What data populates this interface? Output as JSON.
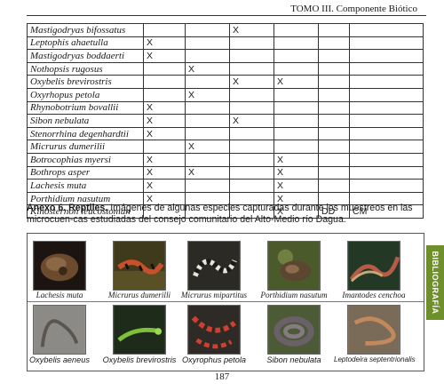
{
  "header": {
    "title": "TOMO III. Componente Biótico"
  },
  "table": {
    "rows": [
      [
        "Mastigodryas bifossatus",
        "",
        "",
        "X",
        "",
        "",
        ""
      ],
      [
        "Leptophis ahaetulla",
        "X",
        "",
        "",
        "",
        "",
        ""
      ],
      [
        "Mastigodryas boddaerti",
        "X",
        "",
        "",
        "",
        "",
        ""
      ],
      [
        "Nothopsis rugosus",
        "",
        "X",
        "",
        "",
        "",
        ""
      ],
      [
        "Oxybelis brevirostris",
        "",
        "",
        "X",
        "X",
        "",
        ""
      ],
      [
        "Oxyrhopus petola",
        "",
        "X",
        "",
        "",
        "",
        ""
      ],
      [
        "Rhynobotrium bovallii",
        "X",
        "",
        "",
        "",
        "",
        ""
      ],
      [
        "Sibon nebulata",
        "X",
        "",
        "X",
        "",
        "",
        ""
      ],
      [
        "Stenorrhina degenhardtii",
        "X",
        "",
        "",
        "",
        "",
        ""
      ],
      [
        "Micrurus dumerilii",
        "",
        "X",
        "",
        "",
        "",
        ""
      ],
      [
        "Botrocophias myersi",
        "X",
        "",
        "",
        "X",
        "",
        ""
      ],
      [
        "Bothrops asper",
        "X",
        "X",
        "",
        "X",
        "",
        ""
      ],
      [
        "Lachesis muta",
        "X",
        "",
        "",
        "X",
        "",
        ""
      ],
      [
        "Porthidium nasutum",
        "X",
        "",
        "",
        "X",
        "",
        ""
      ],
      [
        "Kinosternon leucostomun",
        "",
        "",
        "",
        "X",
        "DD",
        "CM"
      ]
    ]
  },
  "annex": {
    "label": "Anexo 6. Reptiles.",
    "text": " Imágenes de algunas especies capturadas durante los muestreos en  las microcuen-cas estudiadas del consejo comunitario del Alto-Medio río Dagua."
  },
  "gallery": {
    "row1": [
      "Lachesis muta",
      "Micrurus dumerilli",
      "Micrurus mipartitus",
      "Porthidium nasutum",
      "Imantodes cenchoa"
    ],
    "row2": [
      "Oxybelis aeneus",
      "Oxybelis brevirostris",
      "Oxyrophus petola",
      "Sibon nebulata",
      "Leptodeira septentrionalis"
    ]
  },
  "side_tab": {
    "label": "BIBLIOGRAFÍA",
    "color": "#6f8e2c"
  },
  "page_number": "187"
}
